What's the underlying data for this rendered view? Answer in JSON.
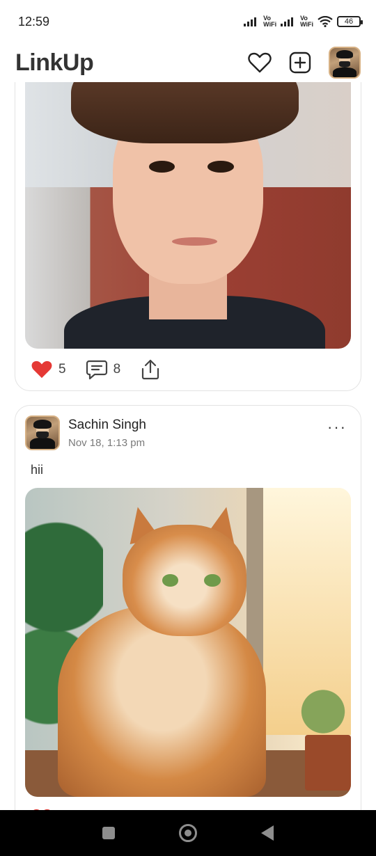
{
  "status_bar": {
    "time": "12:59",
    "network_label_1": "Vo\nWiFi",
    "network_label_2": "Vo\nWiFi",
    "battery": "46"
  },
  "app_bar": {
    "title": "LinkUp",
    "icons": [
      "heart-icon",
      "add-post-icon",
      "profile-avatar"
    ]
  },
  "feed": {
    "posts": [
      {
        "image_desc": "boy portrait",
        "likes": "5",
        "comments": "8",
        "liked": true
      },
      {
        "author": "Sachin Singh",
        "time": "Nov 18, 1:13 pm",
        "text": "hii",
        "more": "···",
        "image_desc": "cat by window"
      }
    ]
  },
  "colors": {
    "accent_like": "#e53935",
    "text_primary": "#222222",
    "text_secondary": "#7a7a7a",
    "card_border": "#e3e3e3"
  }
}
